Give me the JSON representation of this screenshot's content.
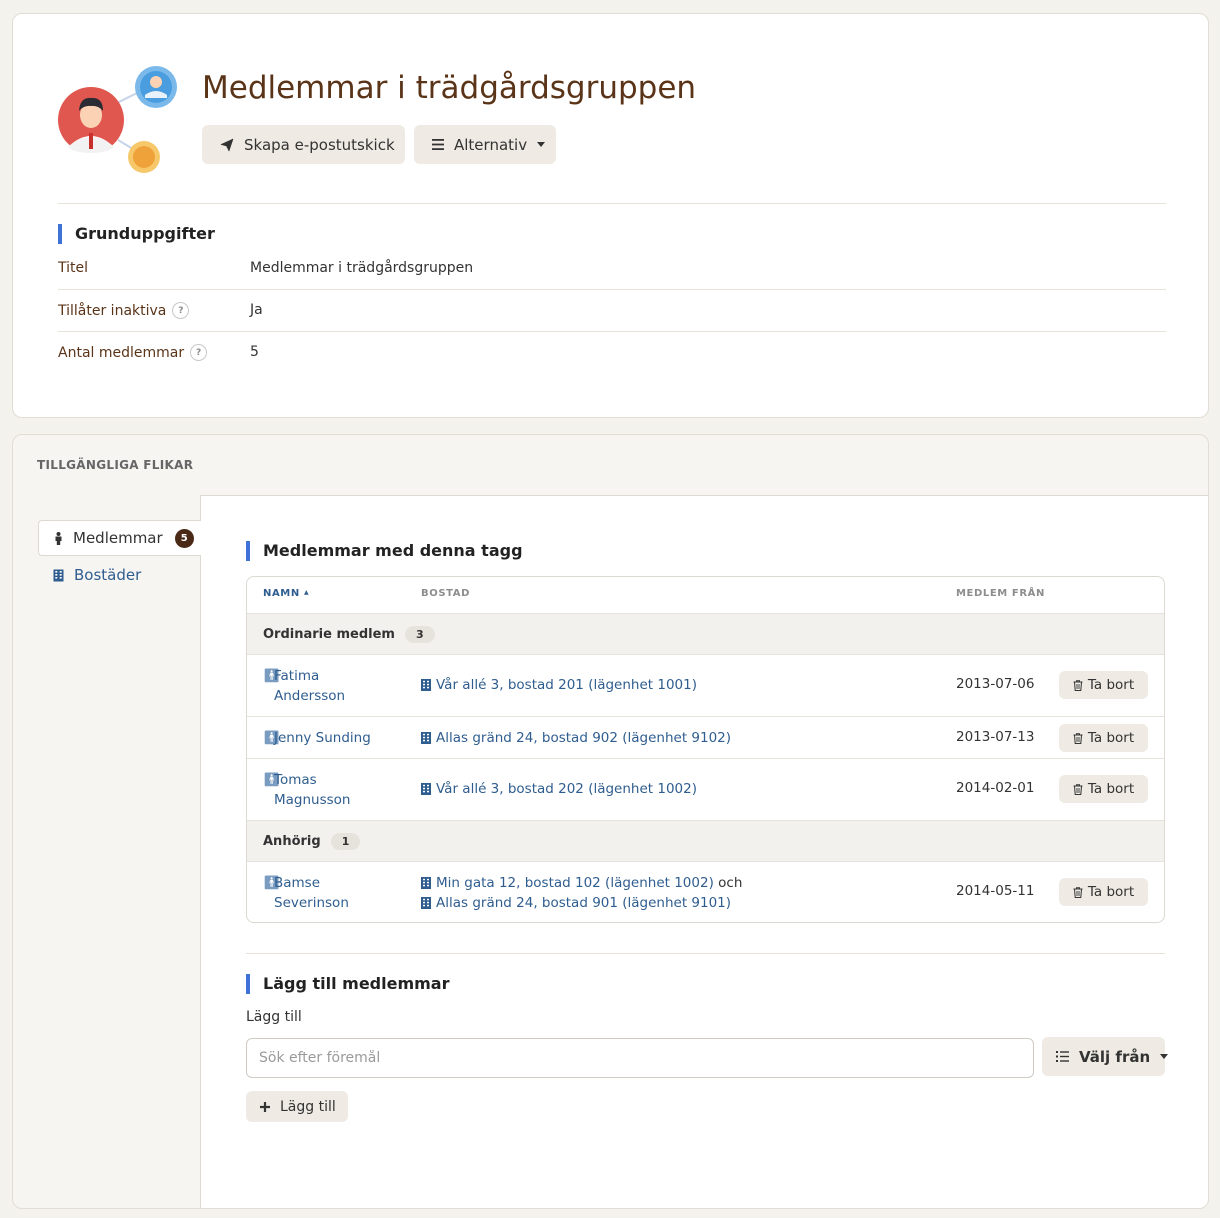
{
  "header": {
    "title": "Medlemmar i trädgårdsgruppen",
    "send_email_label": "Skapa e-postutskick",
    "options_label": "Alternativ"
  },
  "basic_info": {
    "heading": "Grunduppgifter",
    "rows": [
      {
        "label": "Titel",
        "value": "Medlemmar i trädgårdsgruppen"
      },
      {
        "label": "Tillåter inaktiva",
        "value": "Ja"
      },
      {
        "label": "Antal medlemmar",
        "value": "5"
      }
    ],
    "help_symbol": "?"
  },
  "tabs_panel": {
    "heading": "TILLGÄNGLIGA FLIKAR",
    "tabs": [
      {
        "label": "Medlemmar",
        "count": "5",
        "icon": "person-icon",
        "active": true
      },
      {
        "label": "Bostäder",
        "icon": "building-icon",
        "active": false
      }
    ]
  },
  "members_section": {
    "heading": "Medlemmar med denna tagg",
    "columns": {
      "name": "NAMN",
      "address": "BOSTAD",
      "member_since": "MEDLEM FRÅN"
    },
    "sort_indicator": "▲",
    "groups": [
      {
        "label": "Ordinarie medlem",
        "count": "3",
        "members": [
          {
            "first": "Fatima",
            "last": "Andersson",
            "address": [
              "Vår allé 3, bostad 201 (lägenhet 1001)"
            ],
            "since": "2013-07-06"
          },
          {
            "first": "Jenny Sunding",
            "last": "",
            "address": [
              "Allas gränd 24, bostad 902 (lägenhet 9102)"
            ],
            "since": "2013-07-13"
          },
          {
            "first": "Tomas",
            "last": "Magnusson",
            "address": [
              "Vår allé 3, bostad 202 (lägenhet 1002)"
            ],
            "since": "2014-02-01"
          }
        ]
      },
      {
        "label": "Anhörig",
        "count": "1",
        "members": [
          {
            "first": "Bamse",
            "last": "Severinson",
            "address": [
              "Min gata 12, bostad 102 (lägenhet 1002)",
              "Allas gränd 24, bostad 901 (lägenhet 9101)"
            ],
            "since": "2014-05-11"
          }
        ]
      }
    ],
    "address_joiner": "och",
    "remove_label": "Ta bort"
  },
  "add_section": {
    "heading": "Lägg till medlemmar",
    "field_label": "Lägg till",
    "search_placeholder": "Sök efter föremål",
    "choose_label": "Välj från",
    "add_label": "Lägg till"
  },
  "colors": {
    "title": "#5a3418",
    "link": "#2f5d8f",
    "accent": "#3f72d6",
    "button_bg": "#efebe4",
    "badge_bg": "#4a2a16"
  }
}
